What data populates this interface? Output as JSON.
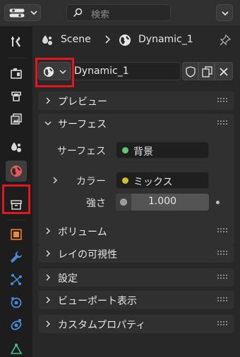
{
  "header": {
    "editor_type_icon": "properties-editor-icon",
    "search_placeholder": "検索",
    "filter_icon": "chevron-down-icon"
  },
  "tabs": [
    {
      "name": "tool-tab",
      "icon": "tool-icon"
    },
    {
      "name": "render-tab",
      "icon": "render-icon"
    },
    {
      "name": "output-tab",
      "icon": "output-icon"
    },
    {
      "name": "view-layer-tab",
      "icon": "view-layer-icon"
    },
    {
      "name": "scene-tab",
      "icon": "scene-icon"
    },
    {
      "name": "world-tab",
      "icon": "world-icon",
      "active": true
    },
    {
      "name": "collection-tab",
      "icon": "collection-icon"
    },
    {
      "name": "object-tab",
      "icon": "object-icon"
    },
    {
      "name": "modifier-tab",
      "icon": "wrench-icon"
    },
    {
      "name": "particles-tab",
      "icon": "particles-icon"
    },
    {
      "name": "physics-tab",
      "icon": "physics-icon"
    },
    {
      "name": "constraints-tab",
      "icon": "constraint-icon"
    },
    {
      "name": "data-tab",
      "icon": "data-icon"
    }
  ],
  "breadcrumb": {
    "scene_label": "Scene",
    "world_label": "Dynamic_1"
  },
  "datablock": {
    "name": "Dynamic_1"
  },
  "panels": {
    "preview": "プレビュー",
    "surface": "サーフェス",
    "volume": "ボリューム",
    "ray_visibility": "レイの可視性",
    "settings": "設定",
    "viewport_display": "ビューポート表示",
    "custom_properties": "カスタムプロパティ"
  },
  "surface": {
    "surface_label": "サーフェス",
    "surface_value": "背景",
    "surface_dot_color": "#5cc96f",
    "color_label": "カラー",
    "color_value": "ミックス",
    "color_dot_color": "#d2c12c",
    "strength_label": "強さ",
    "strength_value": "1.000"
  },
  "colors": {
    "highlight": "#e3161f",
    "world_accent": "#e05a5a",
    "object_accent": "#f28a2d",
    "modifier_accent": "#4a8ad6"
  }
}
